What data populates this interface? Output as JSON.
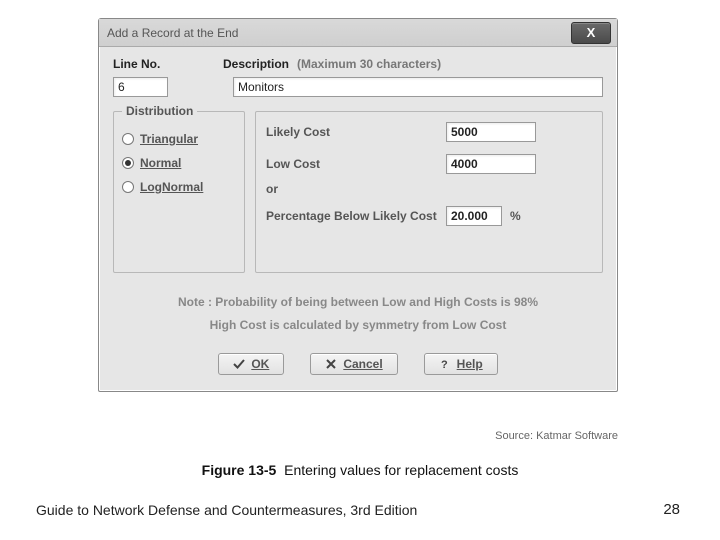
{
  "window": {
    "title": "Add a Record at the End"
  },
  "labels": {
    "line_no": "Line No.",
    "description": "Description",
    "max_chars": "(Maximum 30 characters)",
    "distribution": "Distribution",
    "likely_cost": "Likely Cost",
    "low_cost": "Low Cost",
    "or": "or",
    "pct_below": "Percentage Below Likely Cost",
    "pct_sign": "%"
  },
  "fields": {
    "line_no": "6",
    "description": "Monitors",
    "likely_cost": "5000",
    "low_cost": "4000",
    "pct_below": "20.000"
  },
  "distribution": {
    "triangular": "Triangular",
    "normal": "Normal",
    "lognormal": "LogNormal",
    "selected": "normal"
  },
  "notes": {
    "line1": "Note : Probability of being between Low and High Costs is 98%",
    "line2": "High Cost is calculated by symmetry from Low Cost"
  },
  "buttons": {
    "ok": "OK",
    "cancel": "Cancel",
    "help": "Help"
  },
  "source": "Source: Katmar Software",
  "caption": {
    "fig": "Figure 13-5",
    "text": "Entering values for replacement costs"
  },
  "footer": {
    "left": "Guide to Network Defense and Countermeasures, 3rd Edition",
    "page": "28"
  }
}
